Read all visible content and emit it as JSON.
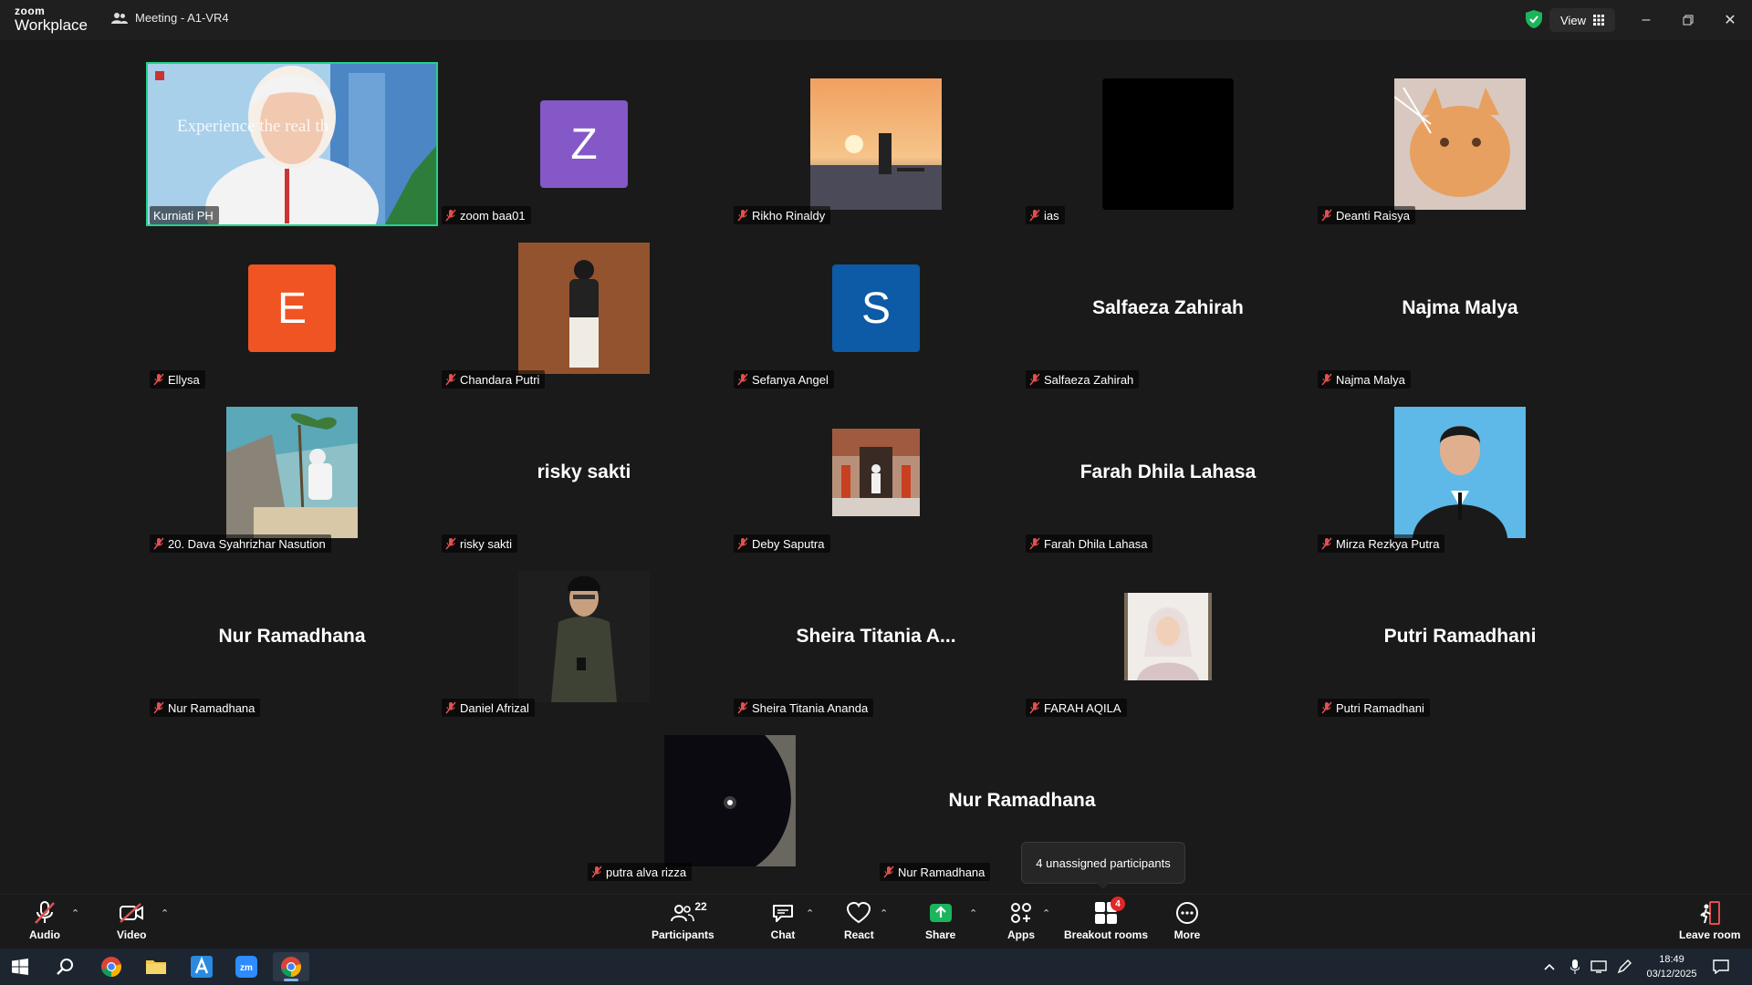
{
  "app": {
    "logo_top": "zoom",
    "logo_bottom": "Workplace",
    "meeting_title": "Meeting - A1-VR4",
    "view_label": "View"
  },
  "colors": {
    "active_speaker_border": "#23d18b",
    "avatar_purple": "#8458c6",
    "avatar_orange": "#f05423",
    "avatar_blue": "#0d5aa6",
    "security_green": "#1bb55c"
  },
  "participants": [
    {
      "name": "Kurniati PH",
      "kind": "video",
      "active_speaker": true,
      "slide_text": "Experience the real th",
      "muted": false
    },
    {
      "name": "zoom baa01",
      "kind": "letter",
      "letter": "Z",
      "muted": true
    },
    {
      "name": "Rikho Rinaldy",
      "kind": "photo",
      "muted": true
    },
    {
      "name": "ias",
      "kind": "photo",
      "muted": true
    },
    {
      "name": "Deanti Raisya",
      "kind": "photo",
      "muted": true
    },
    {
      "name": "Ellysa",
      "kind": "letter",
      "letter": "E",
      "muted": true
    },
    {
      "name": "Chandara Putri",
      "kind": "photo",
      "muted": true
    },
    {
      "name": "Sefanya Angel",
      "kind": "letter",
      "letter": "S",
      "muted": true
    },
    {
      "name": "Salfaeza Zahirah",
      "kind": "name",
      "display": "Salfaeza Zahirah",
      "muted": true
    },
    {
      "name": "Najma Malya",
      "kind": "name",
      "display": "Najma Malya",
      "muted": true
    },
    {
      "name": "20. Dava Syahrizhar Nasution",
      "kind": "photo",
      "muted": true
    },
    {
      "name": "risky sakti",
      "kind": "name",
      "display": "risky sakti",
      "muted": true
    },
    {
      "name": "Deby Saputra",
      "kind": "photo",
      "muted": true
    },
    {
      "name": "Farah Dhila Lahasa",
      "kind": "name",
      "display": "Farah Dhila Lahasa",
      "muted": true
    },
    {
      "name": "Mirza Rezkya Putra",
      "kind": "photo",
      "muted": true
    },
    {
      "name": "Nur Ramadhana",
      "kind": "name",
      "display": "Nur Ramadhana",
      "muted": true
    },
    {
      "name": "Daniel Afrizal",
      "kind": "photo",
      "muted": true
    },
    {
      "name": "Sheira Titania Ananda",
      "kind": "name",
      "display": "Sheira Titania A...",
      "muted": true
    },
    {
      "name": "FARAH AQILA",
      "kind": "photo",
      "muted": true
    },
    {
      "name": "Putri Ramadhani",
      "kind": "name",
      "display": "Putri Ramadhani",
      "muted": true
    },
    {
      "name": "putra alva rizza",
      "kind": "photo",
      "muted": true
    },
    {
      "name": "Nur Ramadhana",
      "kind": "name",
      "display": "Nur Ramadhana",
      "muted": true
    }
  ],
  "tooltip": "4 unassigned participants",
  "toolbar": {
    "audio": "Audio",
    "video": "Video",
    "participants": "Participants",
    "participants_count": "22",
    "chat": "Chat",
    "react": "React",
    "share": "Share",
    "apps": "Apps",
    "breakout": "Breakout rooms",
    "breakout_badge": "4",
    "more": "More",
    "leave": "Leave room"
  },
  "taskbar": {
    "time": "18:49",
    "date": "03/12/2025"
  }
}
